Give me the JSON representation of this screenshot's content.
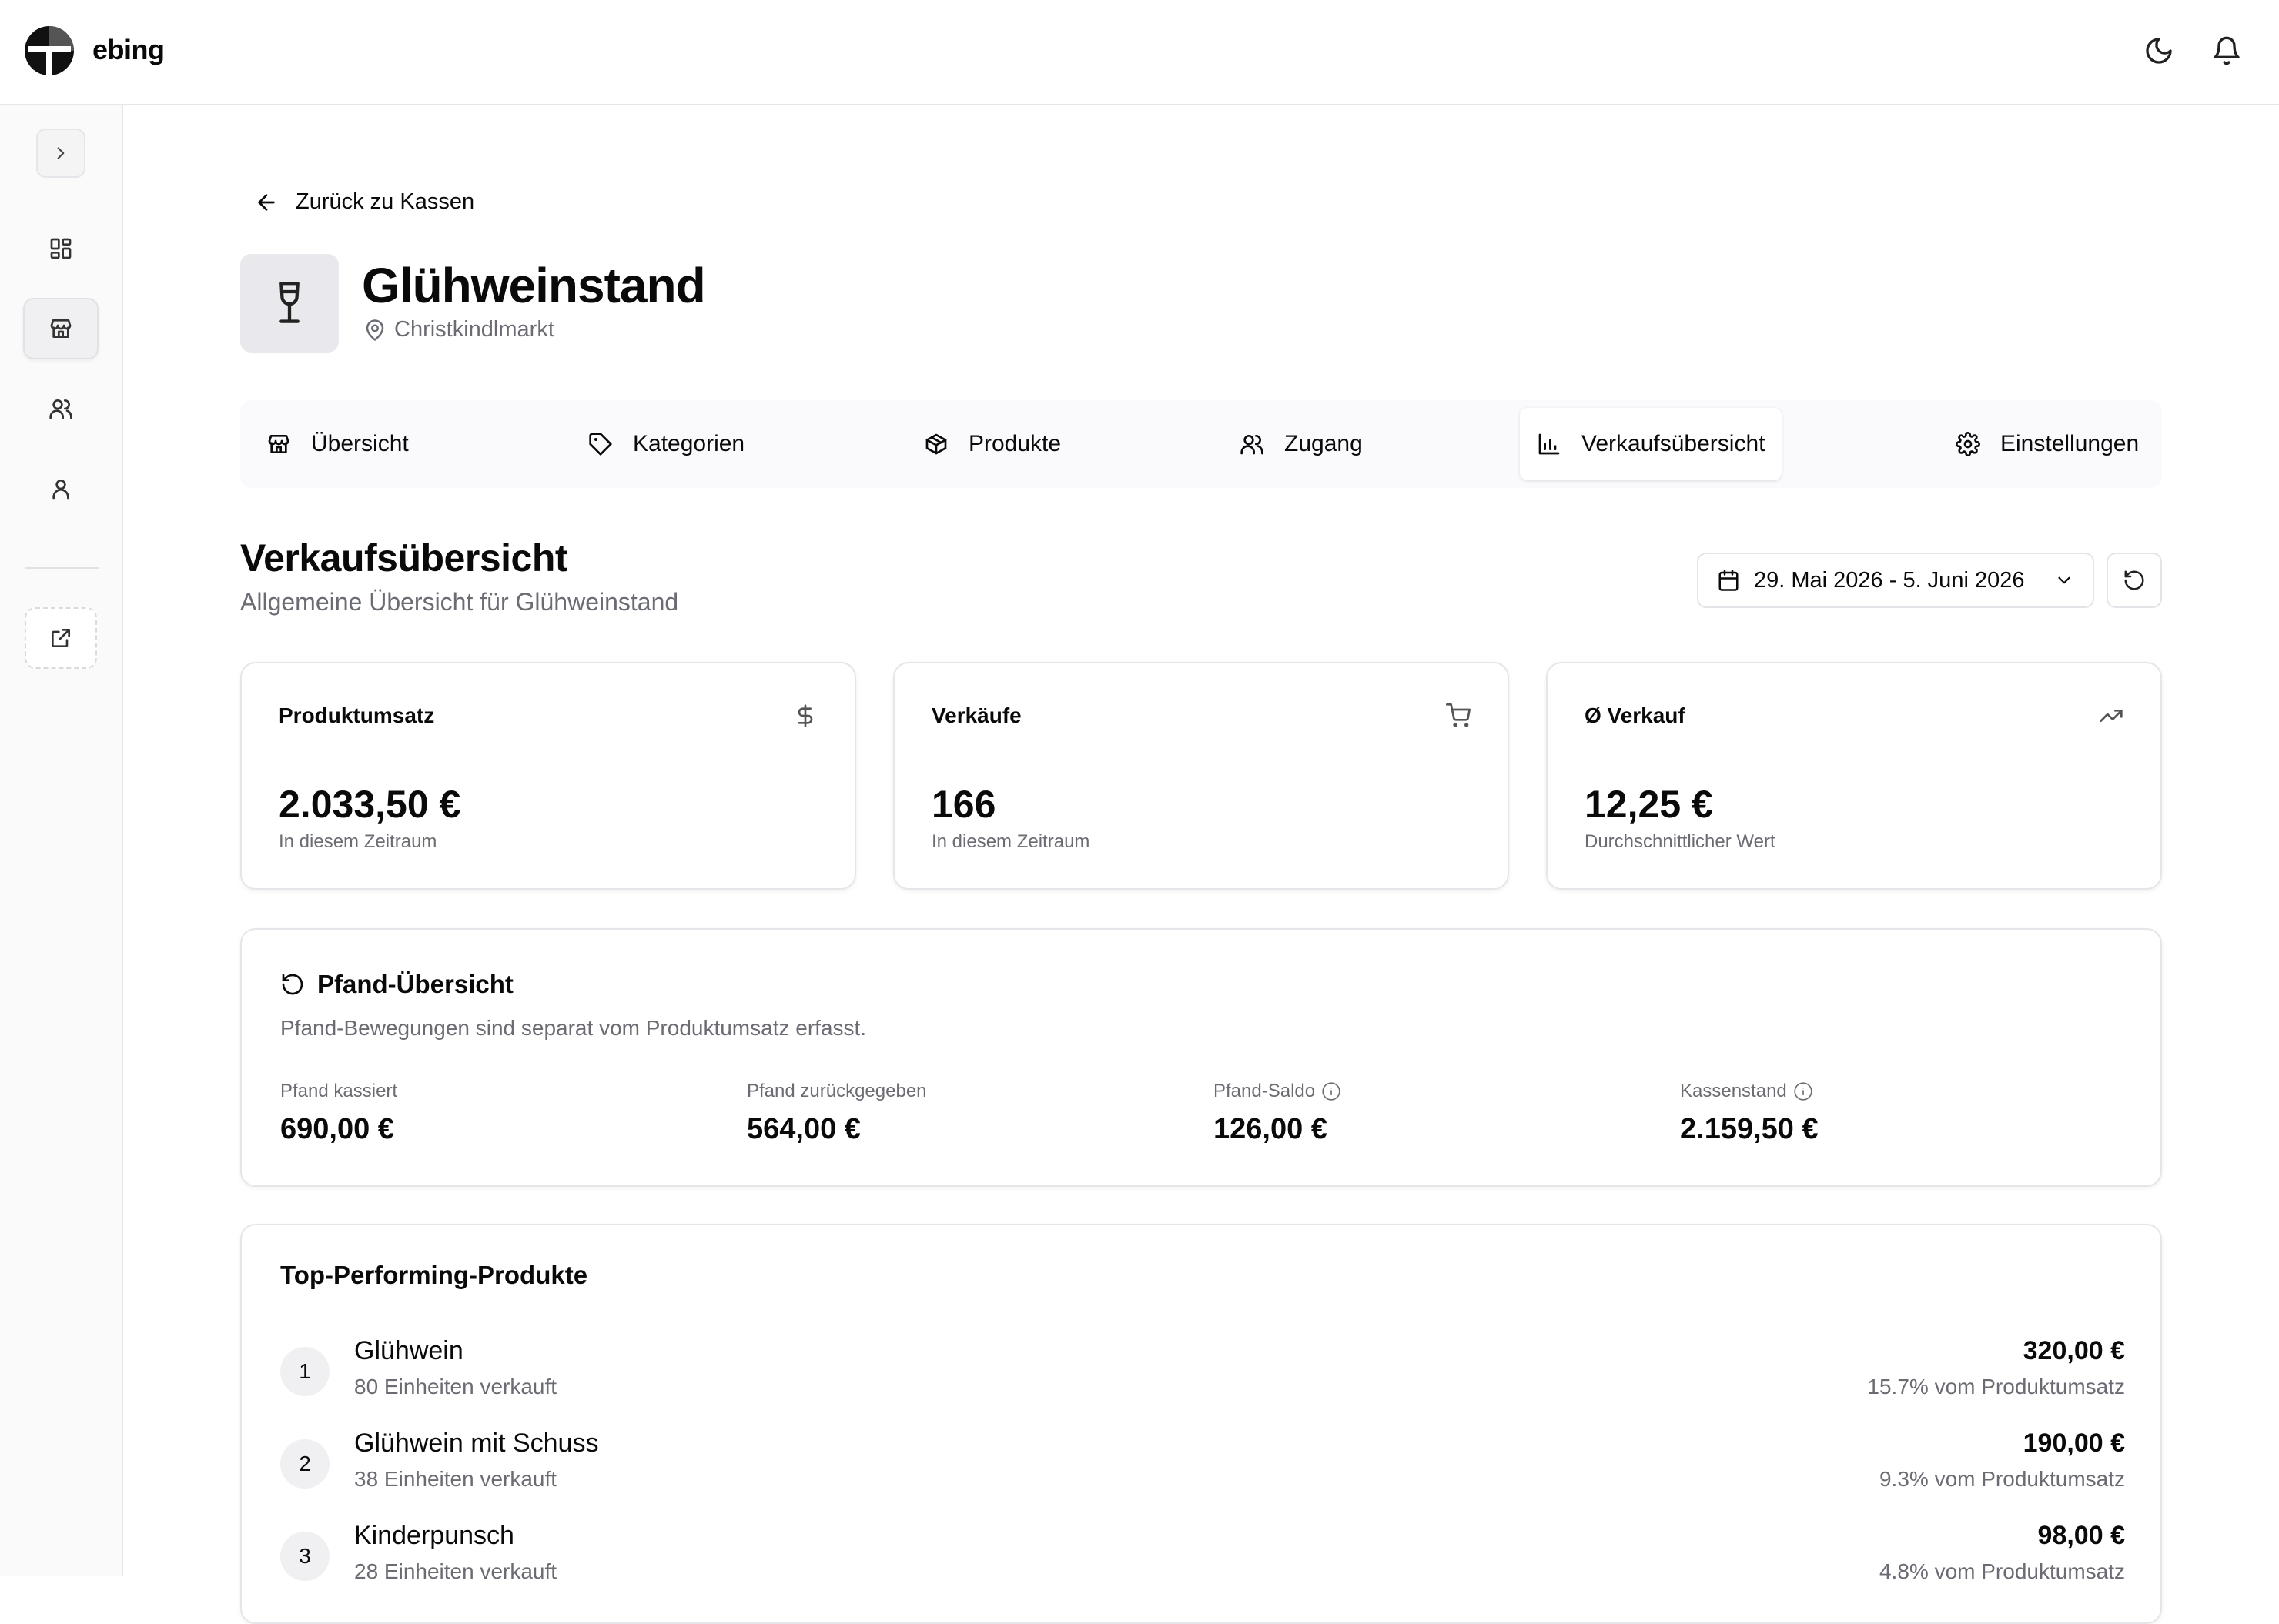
{
  "app": {
    "brand": "ebing"
  },
  "back": {
    "label": "Zurück zu Kassen"
  },
  "store": {
    "name": "Glühweinstand",
    "location": "Christkindlmarkt"
  },
  "tabs": [
    {
      "label": "Übersicht",
      "icon": "store-icon"
    },
    {
      "label": "Kategorien",
      "icon": "tag-icon"
    },
    {
      "label": "Produkte",
      "icon": "box-icon"
    },
    {
      "label": "Zugang",
      "icon": "users-icon"
    },
    {
      "label": "Verkaufsübersicht",
      "icon": "bar-chart-icon",
      "active": true
    },
    {
      "label": "Einstellungen",
      "icon": "gear-icon"
    }
  ],
  "section": {
    "title": "Verkaufsübersicht",
    "subtitle": "Allgemeine Übersicht für Glühweinstand",
    "date_range": "29. Mai 2026 - 5. Juni 2026"
  },
  "stats": [
    {
      "label": "Produktumsatz",
      "value": "2.033,50 €",
      "hint": "In diesem Zeitraum",
      "icon": "dollar-icon"
    },
    {
      "label": "Verkäufe",
      "value": "166",
      "hint": "In diesem Zeitraum",
      "icon": "cart-icon"
    },
    {
      "label": "Ø Verkauf",
      "value": "12,25 €",
      "hint": "Durchschnittlicher Wert",
      "icon": "trending-up-icon"
    }
  ],
  "pfand": {
    "title": "Pfand-Übersicht",
    "description": "Pfand-Bewegungen sind separat vom Produktumsatz erfasst.",
    "items": [
      {
        "label": "Pfand kassiert",
        "value": "690,00 €",
        "info": false
      },
      {
        "label": "Pfand zurückgegeben",
        "value": "564,00 €",
        "info": false
      },
      {
        "label": "Pfand-Saldo",
        "value": "126,00 €",
        "info": true
      },
      {
        "label": "Kassenstand",
        "value": "2.159,50 €",
        "info": true
      }
    ]
  },
  "top_products": {
    "title": "Top-Performing-Produkte",
    "items": [
      {
        "rank": "1",
        "name": "Glühwein",
        "sold": "80 Einheiten verkauft",
        "amount": "320,00 €",
        "share": "15.7% vom Produktumsatz"
      },
      {
        "rank": "2",
        "name": "Glühwein mit Schuss",
        "sold": "38 Einheiten verkauft",
        "amount": "190,00 €",
        "share": "9.3% vom Produktumsatz"
      },
      {
        "rank": "3",
        "name": "Kinderpunsch",
        "sold": "28 Einheiten verkauft",
        "amount": "98,00 €",
        "share": "4.8% vom Produktumsatz"
      }
    ]
  }
}
